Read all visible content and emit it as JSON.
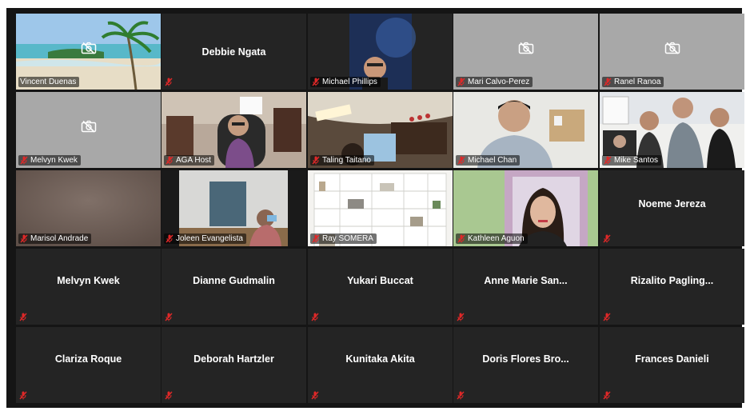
{
  "colors": {
    "tile_background": "#242424",
    "gallery_background": "#151515",
    "active_speaker_border": "#cfd73a",
    "muted_icon": "#e02828"
  },
  "row1": {
    "vincent": "Vincent Duenas",
    "debbie": "Debbie Ngata",
    "michael_phillips": "Michael Phillips",
    "mari": "Mari Calvo-Perez",
    "ranel": "Ranel Ranoa"
  },
  "row2": {
    "melvyn": "Melvyn Kwek",
    "aga": "AGA Host",
    "taling": "Taling Taitano",
    "michael_chan": "Michael Chan",
    "mike": "Mike Santos"
  },
  "row3": {
    "marisol": "Marisol Andrade",
    "joleen": "Joleen Evangelista",
    "ray": "Ray SOMERA",
    "kathleen": "Kathleen Aguon",
    "noeme": "Noeme Jereza"
  },
  "row4": {
    "melvyn": "Melvyn Kwek",
    "dianne": "Dianne Gudmalin",
    "yukari": "Yukari Buccat",
    "anne": "Anne Marie San...",
    "rizalito": "Rizalito  Pagling..."
  },
  "row5": {
    "clariza": "Clariza Roque",
    "deborah": "Deborah Hartzler",
    "kunitaka": "Kunitaka Akita",
    "doris": "Doris Flores Bro...",
    "frances": "Frances Danieli"
  }
}
